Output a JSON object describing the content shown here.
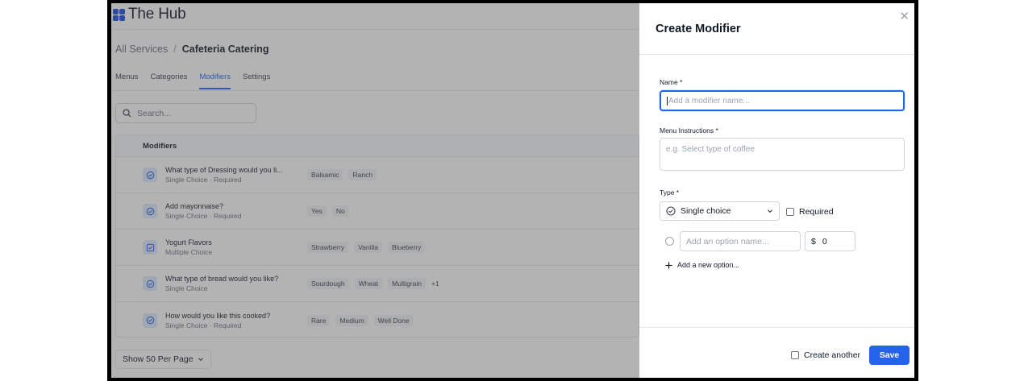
{
  "app": {
    "name": "The Hub",
    "brand_color": "#1d4ed8",
    "accent": "#2563eb"
  },
  "breadcrumb": {
    "root": "All Services",
    "separator": "/",
    "current": "Cafeteria Catering"
  },
  "tabs": [
    {
      "label": "Menus",
      "active": false
    },
    {
      "label": "Categories",
      "active": false
    },
    {
      "label": "Modifiers",
      "active": true
    },
    {
      "label": "Settings",
      "active": false
    }
  ],
  "search": {
    "placeholder": "Search...",
    "icon": "search-icon"
  },
  "table": {
    "header": "Modifiers",
    "rows": [
      {
        "icon": "radio-check-icon",
        "title": "What type of Dressing would you li...",
        "subtitle": "Single Choice · Required",
        "options": [
          "Balsamic",
          "Ranch"
        ],
        "more": ""
      },
      {
        "icon": "radio-check-icon",
        "title": "Add mayonnaise?",
        "subtitle": "Single Choice · Required",
        "options": [
          "Yes",
          "No"
        ],
        "more": ""
      },
      {
        "icon": "checkbox-icon",
        "title": "Yogurt Flavors",
        "subtitle": "Multiple Choice",
        "options": [
          "Strawberry",
          "Vanilla",
          "Blueberry"
        ],
        "more": ""
      },
      {
        "icon": "radio-check-icon",
        "title": "What type of bread would you like?",
        "subtitle": "Single Choice",
        "options": [
          "Sourdough",
          "Wheat",
          "Multigrain"
        ],
        "more": "+1"
      },
      {
        "icon": "radio-check-icon",
        "title": "How would you like this cooked?",
        "subtitle": "Single Choice · Required",
        "options": [
          "Rare",
          "Medium",
          "Well Done"
        ],
        "more": ""
      }
    ]
  },
  "pagination": {
    "label": "Show 50 Per Page"
  },
  "drawer": {
    "title": "Create Modifier",
    "name_label": "Name *",
    "name_placeholder": "Add a modifier name...",
    "instructions_label": "Menu Instructions *",
    "instructions_placeholder": "e.g. Select type of coffee",
    "type_label": "Type *",
    "type_value": "Single choice",
    "required_label": "Required",
    "option_placeholder": "Add an option name...",
    "price_prefix": "$",
    "price_value": "0",
    "add_option_label": "Add a new option...",
    "create_another_label": "Create another",
    "save_label": "Save"
  }
}
